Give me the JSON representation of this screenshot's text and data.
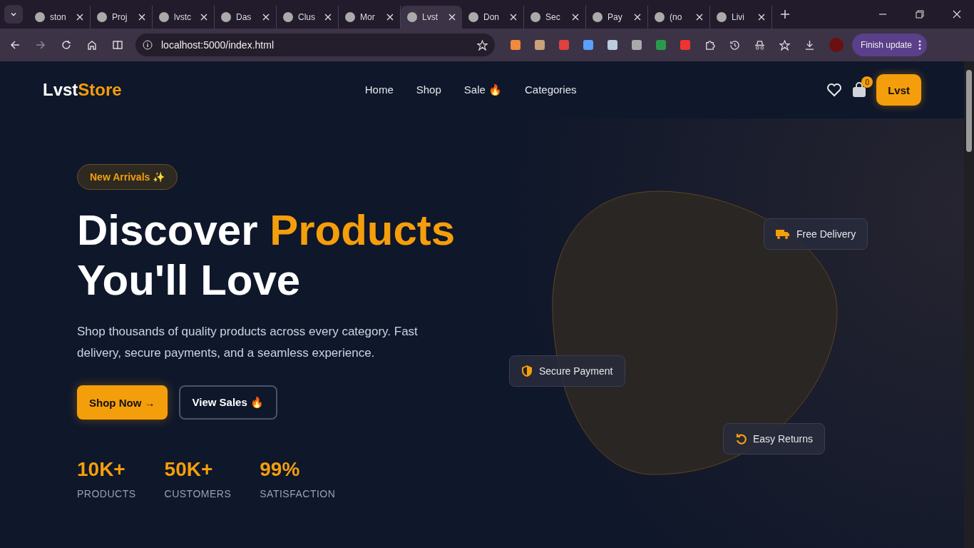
{
  "browser": {
    "tabs": [
      {
        "title": "ston",
        "selected": false
      },
      {
        "title": "Proj",
        "selected": false
      },
      {
        "title": "lvstc",
        "selected": false
      },
      {
        "title": "Das",
        "selected": false
      },
      {
        "title": "Clus",
        "selected": false
      },
      {
        "title": "Mor",
        "selected": false
      },
      {
        "title": "Lvst",
        "selected": true
      },
      {
        "title": "Don",
        "selected": false
      },
      {
        "title": "Sec",
        "selected": false
      },
      {
        "title": "Pay",
        "selected": false
      },
      {
        "title": "(no",
        "selected": false
      },
      {
        "title": "Livi",
        "selected": false
      }
    ],
    "address": "localhost:5000/index.html",
    "update_button": "Finish update"
  },
  "header": {
    "logo": [
      {
        "text": "Lvst",
        "accent": false
      },
      {
        "text": "Store",
        "accent": true
      }
    ],
    "nav": [
      "Home",
      "Shop",
      "Sale 🔥",
      "Categories"
    ],
    "cart_count": "0",
    "account_button": "Lvst"
  },
  "hero": {
    "badge": "New Arrivals ✨",
    "title": [
      {
        "text": "Discover ",
        "accent": false
      },
      {
        "text": "Products",
        "accent": true
      },
      {
        "text": "You'll Love",
        "accent": false
      }
    ],
    "description": "Shop thousands of quality products across every category. Fast delivery, secure payments, and a seamless experience.",
    "buttons": [
      {
        "label": "Shop Now →",
        "kind": "primary"
      },
      {
        "label": "View Sales 🔥",
        "kind": "outline"
      }
    ],
    "stats": [
      {
        "value": "10K+",
        "label": "PRODUCTS"
      },
      {
        "value": "50K+",
        "label": "CUSTOMERS"
      },
      {
        "value": "99%",
        "label": "SATISFACTION"
      }
    ],
    "features": [
      {
        "label": "Free Delivery",
        "kind": "truck"
      },
      {
        "label": "Secure Payment",
        "kind": "shield"
      },
      {
        "label": "Easy Returns",
        "kind": "returns"
      }
    ]
  }
}
